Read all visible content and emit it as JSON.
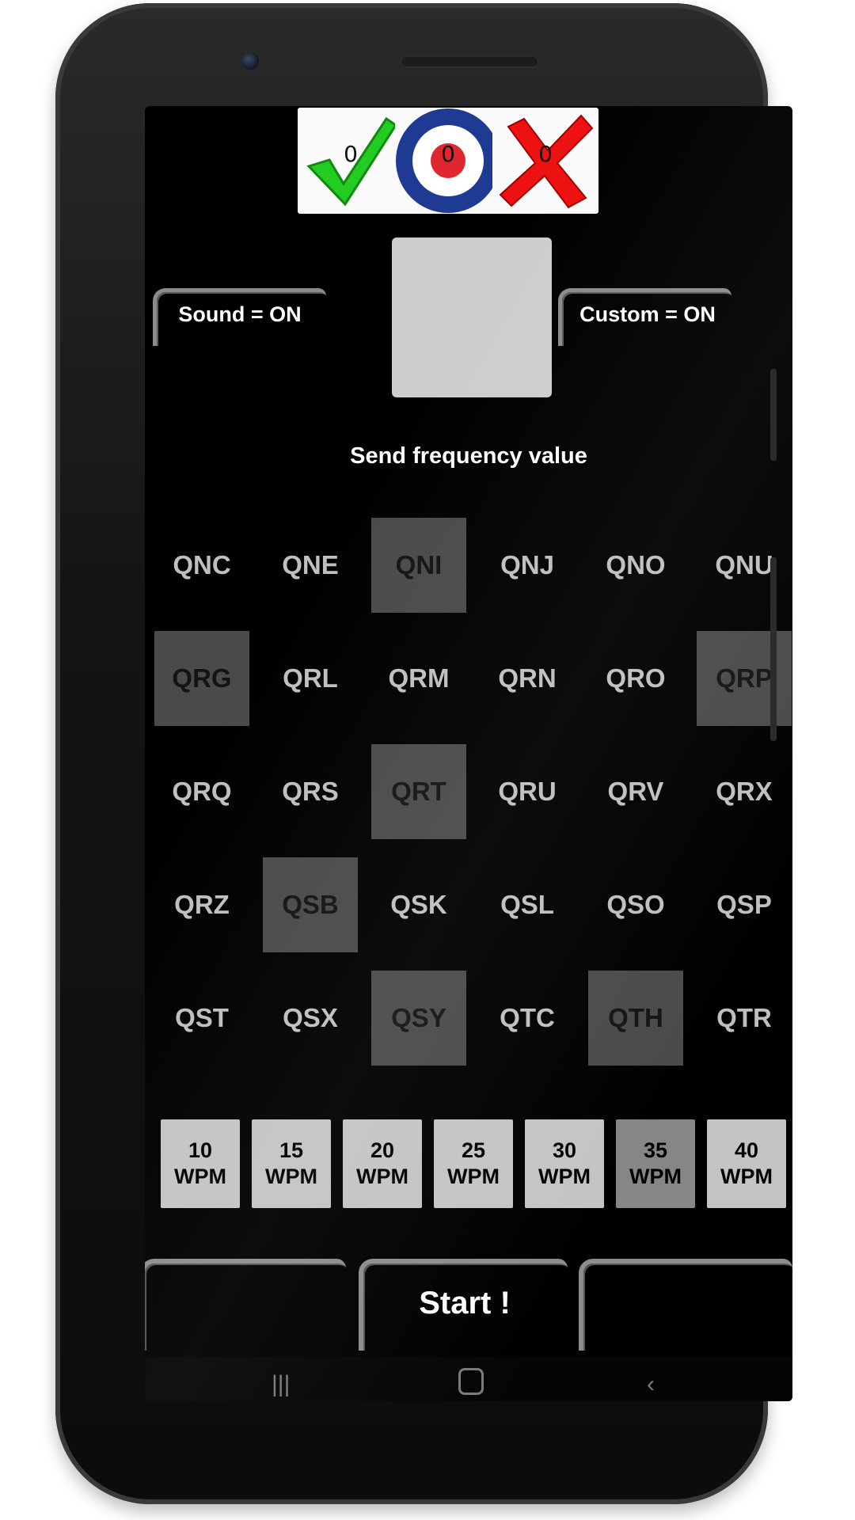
{
  "scores": {
    "correct": {
      "icon": "checkmark-icon",
      "count": "0",
      "color": "#22cc22"
    },
    "target": {
      "icon": "roundel-target-icon",
      "count": "0",
      "colors": [
        "#1f3a93",
        "#ffffff",
        "#e0262f"
      ]
    },
    "wrong": {
      "icon": "cross-icon",
      "count": "0",
      "color": "#ee1111"
    }
  },
  "tabs": {
    "sound_label": "Sound = ON",
    "custom_label": "Custom = ON"
  },
  "instruction": "Send frequency value",
  "codes": {
    "rows": [
      [
        {
          "label": "QNC",
          "selected": false
        },
        {
          "label": "QNE",
          "selected": false
        },
        {
          "label": "QNI",
          "selected": true
        },
        {
          "label": "QNJ",
          "selected": false
        },
        {
          "label": "QNO",
          "selected": false
        },
        {
          "label": "QNU",
          "selected": false
        }
      ],
      [
        {
          "label": "QRG",
          "selected": true
        },
        {
          "label": "QRL",
          "selected": false
        },
        {
          "label": "QRM",
          "selected": false
        },
        {
          "label": "QRN",
          "selected": false
        },
        {
          "label": "QRO",
          "selected": false
        },
        {
          "label": "QRP",
          "selected": true
        }
      ],
      [
        {
          "label": "QRQ",
          "selected": false
        },
        {
          "label": "QRS",
          "selected": false
        },
        {
          "label": "QRT",
          "selected": true
        },
        {
          "label": "QRU",
          "selected": false
        },
        {
          "label": "QRV",
          "selected": false
        },
        {
          "label": "QRX",
          "selected": false
        }
      ],
      [
        {
          "label": "QRZ",
          "selected": false
        },
        {
          "label": "QSB",
          "selected": true
        },
        {
          "label": "QSK",
          "selected": false
        },
        {
          "label": "QSL",
          "selected": false
        },
        {
          "label": "QSO",
          "selected": false
        },
        {
          "label": "QSP",
          "selected": false
        }
      ],
      [
        {
          "label": "QST",
          "selected": false
        },
        {
          "label": "QSX",
          "selected": false
        },
        {
          "label": "QSY",
          "selected": true
        },
        {
          "label": "QTC",
          "selected": false
        },
        {
          "label": "QTH",
          "selected": true
        },
        {
          "label": "QTR",
          "selected": false
        }
      ]
    ]
  },
  "speeds": [
    {
      "value": "10",
      "unit": "WPM",
      "selected": false
    },
    {
      "value": "15",
      "unit": "WPM",
      "selected": false
    },
    {
      "value": "20",
      "unit": "WPM",
      "selected": false
    },
    {
      "value": "25",
      "unit": "WPM",
      "selected": false
    },
    {
      "value": "30",
      "unit": "WPM",
      "selected": false
    },
    {
      "value": "35",
      "unit": "WPM",
      "selected": true
    },
    {
      "value": "40",
      "unit": "WPM",
      "selected": false
    }
  ],
  "actions": {
    "left_label": "",
    "start_label": "Start !",
    "right_label": ""
  },
  "navbar": {
    "recents_icon": "recents-icon",
    "home_icon": "home-icon",
    "back_icon": "back-icon"
  }
}
